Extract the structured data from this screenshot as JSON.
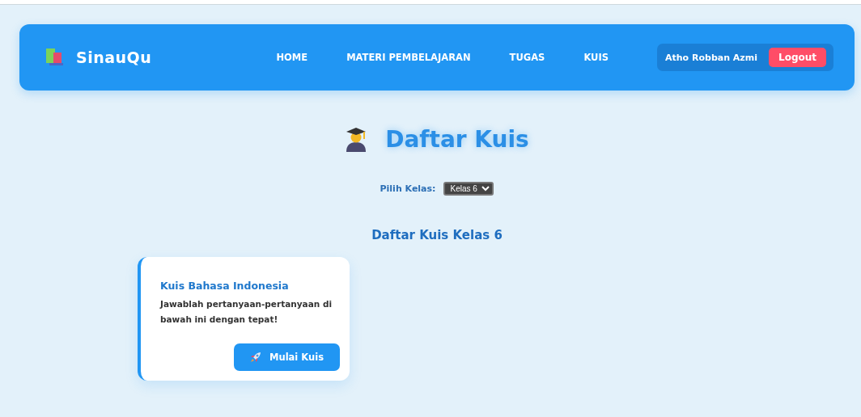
{
  "navbar": {
    "brand": "SinauQu",
    "links": [
      {
        "label": "HOME"
      },
      {
        "label": "MATERI PEMBELAJARAN"
      },
      {
        "label": "TUGAS"
      },
      {
        "label": "KUIS"
      }
    ],
    "user": {
      "name": "Atho Robban Azmi",
      "logout": "Logout"
    }
  },
  "page": {
    "title": "Daftar Kuis",
    "class_filter": {
      "label": "Pilih Kelas:",
      "value": "Kelas 6"
    },
    "subtitle": "Daftar Kuis Kelas 6"
  },
  "quizzes": [
    {
      "title": "Kuis Bahasa Indonesia",
      "description": "Jawablah pertanyaan-pertanyaan di bawah ini dengan tepat!",
      "button": "Mulai Kuis"
    }
  ]
}
